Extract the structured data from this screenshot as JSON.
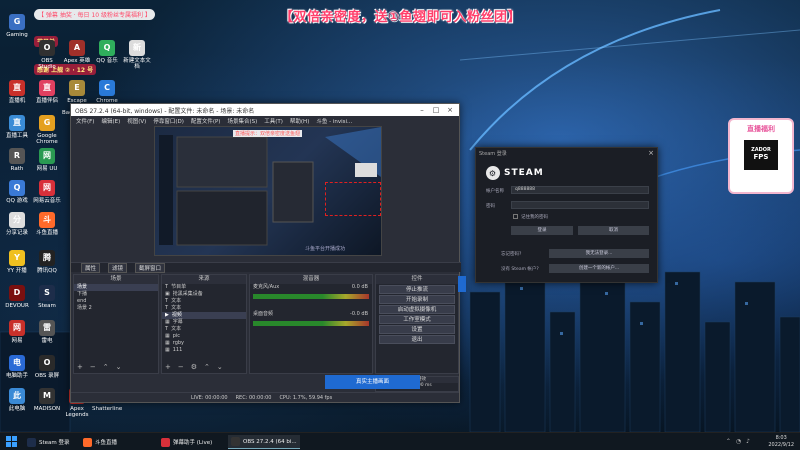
{
  "overlays": {
    "top_banner": "【双倍亲密度，送①鱼翅即可入粉丝团】",
    "scroll_text": "【 弹幕 抽奖 · 每日 10 级粉丝专属福利 】",
    "side_label_1": "节目单",
    "side_label_2": "感谢 上舰 ② · 12 号",
    "promo_title": "直播福利",
    "promo_box_line1": "ZADOR",
    "promo_box_line2": "FPS"
  },
  "desktop_icons": [
    {
      "label": "Gaming",
      "icon": "gamepad-icon",
      "color": "#3a6fc2"
    },
    {
      "label": "OBS Studio",
      "icon": "obs-icon",
      "color": "#303030"
    },
    {
      "label": "Apex 英雄",
      "icon": "apex-icon",
      "color": "#a0302a"
    },
    {
      "label": "QQ 音乐",
      "icon": "music-icon",
      "color": "#2fae5c"
    },
    {
      "label": "新建文本文档",
      "icon": "doc-icon",
      "color": "#dcdcdc"
    },
    {
      "label": "直播机",
      "icon": "live-icon",
      "color": "#c8302a"
    },
    {
      "label": "直播伴侣",
      "icon": "live-icon",
      "color": "#e04060"
    },
    {
      "label": "Escape the Backrooms",
      "icon": "game-icon",
      "color": "#a88a3a"
    },
    {
      "label": "Chrome",
      "icon": "chrome-icon",
      "color": "#2a7ad8"
    },
    {
      "label": "直播工具",
      "icon": "tool-icon",
      "color": "#3a8cd6"
    },
    {
      "label": "Google Chrome",
      "icon": "chrome-icon",
      "color": "#e4a020"
    },
    {
      "label": "Rath",
      "icon": "game-icon",
      "color": "#555"
    },
    {
      "label": "网易 UU",
      "icon": "uu-icon",
      "color": "#2a9a52"
    },
    {
      "label": "QQ 游戏",
      "icon": "qq-icon",
      "color": "#3a7ad6"
    },
    {
      "label": "网易云音乐",
      "icon": "netease-music-icon",
      "color": "#d8303a"
    },
    {
      "label": "分享记录",
      "icon": "doc-icon",
      "color": "#ddd"
    },
    {
      "label": "斗鱼直播",
      "icon": "douyu-icon",
      "color": "#ff6a2a"
    },
    {
      "label": "YY 开播",
      "icon": "yy-icon",
      "color": "#f0c020"
    },
    {
      "label": "腾讯QQ",
      "icon": "qq-icon",
      "color": "#222"
    },
    {
      "label": "DEVOUR",
      "icon": "game-icon",
      "color": "#7a1010"
    },
    {
      "label": "Steam",
      "icon": "steam-icon",
      "color": "#1d2d4a"
    },
    {
      "label": "网易",
      "icon": "netease-icon",
      "color": "#c8302a"
    },
    {
      "label": "雷电",
      "icon": "game-icon",
      "color": "#555"
    },
    {
      "label": "电脑助手",
      "icon": "helper-icon",
      "color": "#2a6ad6"
    },
    {
      "label": "OBS 录屏",
      "icon": "obs-icon",
      "color": "#2a2a2a"
    },
    {
      "label": "此电脑",
      "icon": "pc-icon",
      "color": "#3a8ad6"
    },
    {
      "label": "MADISON",
      "icon": "game-icon",
      "color": "#333"
    },
    {
      "label": "Apex Legends",
      "icon": "apex-icon",
      "color": "#c8302a"
    },
    {
      "label": "Shatterline",
      "icon": "game-icon",
      "color": "#222"
    }
  ],
  "obs": {
    "title": "OBS 27.2.4 (64-bit, windows) - 配置文件: 未命名 - 场景: 未命名",
    "menu": [
      "文件(F)",
      "编辑(E)",
      "视图(V)",
      "停靠窗口(D)",
      "配置文件(P)",
      "场景集合(S)",
      "工具(T)",
      "帮助(H)",
      "斗鱼 - invisi..."
    ],
    "preview_caption": "斗鱼平台开播成功",
    "preview_red": "直播提示：双倍亲密度送鱼翅",
    "scene_bar": [
      "属性",
      "滤镜",
      "截屏窗口"
    ],
    "scenes_header": "场景",
    "scenes": [
      "场景",
      "下播",
      "end",
      "场景 2"
    ],
    "sources_header": "来源",
    "sources": [
      "节目单",
      "抢黑采集设备",
      "文本",
      "文本",
      "视频",
      "字幕",
      "文本",
      "pic",
      "rgby",
      "111"
    ],
    "mixer_header": "混音器",
    "mixer": [
      {
        "name": "麦克风/Aux",
        "db": "0.0 dB"
      },
      {
        "name": "桌面音频",
        "db": "-0.0 dB"
      }
    ],
    "controls_header": "控件",
    "controls": [
      "停止推流",
      "开始录制",
      "启动虚拟摄像机",
      "工作室模式",
      "设置",
      "退出"
    ],
    "transition_header": "转场特效",
    "transition_type": "淡出",
    "transition_duration_label": "时长",
    "transition_duration": "300 ms",
    "status": [
      "LIVE: 00:00:00",
      "REC: 00:00:00",
      "CPU: 1.7%, 59.94 fps"
    ],
    "blue_helper": "真实主播画面"
  },
  "steam": {
    "window_title": "Steam 登录",
    "logo": "STEAM",
    "account_label": "帐户名称",
    "account_value": "q888888",
    "password_label": "密码",
    "remember_label": "记住我的密码",
    "login_button": "登录",
    "cancel_button": "取消",
    "no_account_label": "没有 Steam 帐户?",
    "create_account_button": "创建一个新的帐户...",
    "forgot_label": "忘记密码?",
    "forgot_button": "我无法登录..."
  },
  "taskbar": {
    "items": [
      {
        "label": "Steam 登录",
        "color": "#1d2d4a"
      },
      {
        "label": "斗鱼直播",
        "color": "#ff6a2a"
      },
      {
        "label": "弹幕助手 (Live)",
        "color": "#d8303a"
      },
      {
        "label": "OBS 27.2.4 (64 bi...",
        "color": "#333"
      }
    ],
    "time": "8:03",
    "date": "2022/9/12"
  }
}
